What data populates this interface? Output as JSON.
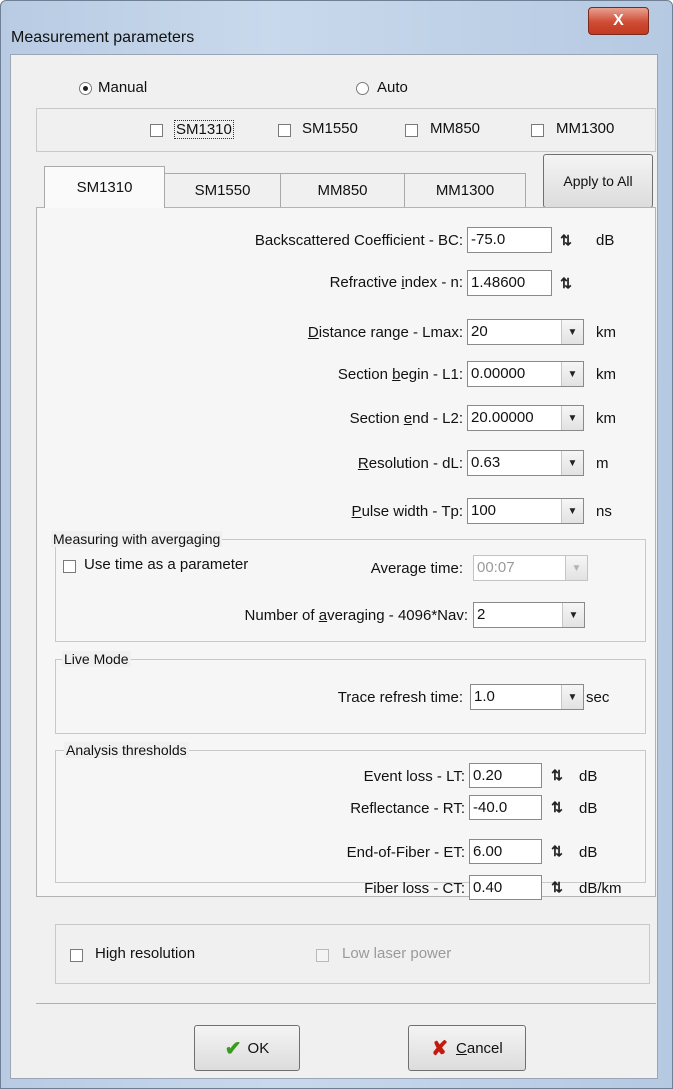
{
  "window": {
    "title": "Measurement parameters",
    "close_label": "X"
  },
  "mode": {
    "manual_label": "Manual",
    "auto_label": "Auto",
    "selected": "Manual"
  },
  "wavelengths": [
    {
      "label": "SM1310",
      "checked": false
    },
    {
      "label": "SM1550",
      "checked": false
    },
    {
      "label": "MM850",
      "checked": false
    },
    {
      "label": "MM1300",
      "checked": false
    }
  ],
  "tabs": [
    "SM1310",
    "SM1550",
    "MM850",
    "MM1300"
  ],
  "active_tab": "SM1310",
  "apply_all_label": "Apply to All",
  "params": {
    "bc": {
      "label": "Backscattered Coefficient - BC:",
      "value": "-75.0",
      "unit": "dB"
    },
    "n": {
      "label_pre": "Refractive ",
      "label_u": "i",
      "label_post": "ndex - n:",
      "value": "1.48600"
    },
    "lmax": {
      "label_u": "D",
      "label_post": "istance range - Lmax:",
      "value": "20",
      "unit": "km"
    },
    "l1": {
      "label_pre": "Section ",
      "label_u": "b",
      "label_post": "egin - L1:",
      "value": "0.00000",
      "unit": "km"
    },
    "l2": {
      "label_pre": "Section ",
      "label_u": "e",
      "label_post": "nd - L2:",
      "value": "20.00000",
      "unit": "km"
    },
    "dl": {
      "label_u": "R",
      "label_post": "esolution - dL:",
      "value": "0.63",
      "unit": "m"
    },
    "tp": {
      "label_u": "P",
      "label_post": "ulse width - Tp:",
      "value": "100",
      "unit": "ns"
    }
  },
  "averaging": {
    "legend": "Measuring with avergaging",
    "use_time_label": "Use time as a parameter",
    "avg_time_label": "Average time:",
    "avg_time_value": "00:07",
    "nav_label_pre": "Number of ",
    "nav_label_u": "a",
    "nav_label_post": "veraging - 4096*Nav:",
    "nav_value": "2"
  },
  "live": {
    "legend": "Live Mode",
    "refresh_label": "Trace refresh time:",
    "refresh_value": "1.0",
    "refresh_unit": "sec"
  },
  "thresholds": {
    "legend": "Analysis thresholds",
    "lt": {
      "label": "Event loss - LT:",
      "value": "0.20",
      "unit": "dB"
    },
    "rt": {
      "label": "Reflectance - RT:",
      "value": "-40.0",
      "unit": "dB"
    },
    "et": {
      "label": "End-of-Fiber - ET:",
      "value": "6.00",
      "unit": "dB"
    },
    "ct": {
      "label": "Fiber loss - CT:",
      "value": "0.40",
      "unit": "dB/km"
    }
  },
  "options": {
    "high_res_label": "High resolution",
    "low_power_label": "Low laser power"
  },
  "buttons": {
    "ok_label": "OK",
    "cancel_label_u": "C",
    "cancel_label_post": "ancel"
  }
}
